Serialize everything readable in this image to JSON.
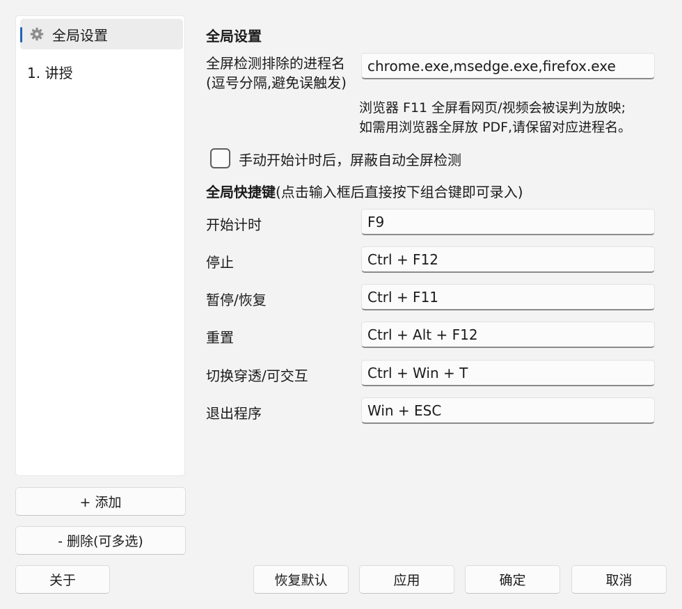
{
  "sidebar": {
    "items": [
      {
        "label": "全局设置",
        "icon": "gear-icon",
        "selected": true
      },
      {
        "label": "1. 讲授",
        "selected": false
      }
    ],
    "add_label": "+  添加",
    "delete_label": "-  删除(可多选)"
  },
  "about_label": "关于",
  "main": {
    "title": "全局设置",
    "exclude": {
      "label_line1": "全屏检测排除的进程名",
      "label_line2": "(逗号分隔,避免误触发)",
      "value": "chrome.exe,msedge.exe,firefox.exe"
    },
    "hint_line1": "浏览器 F11 全屏看网页/视频会被误判为放映;",
    "hint_line2": "如需用浏览器全屏放 PDF,请保留对应进程名。",
    "checkbox_label": "手动开始计时后，屏蔽自动全屏检测",
    "checkbox_checked": false,
    "hotkeys_title": "全局快捷键",
    "hotkeys_subtitle": "(点击输入框后直接按下组合键即可录入)",
    "hotkeys": [
      {
        "label": "开始计时",
        "value": "F9"
      },
      {
        "label": "停止",
        "value": "Ctrl + F12"
      },
      {
        "label": "暂停/恢复",
        "value": "Ctrl + F11"
      },
      {
        "label": "重置",
        "value": "Ctrl + Alt + F12"
      },
      {
        "label": "切换穿透/可交互",
        "value": "Ctrl + Win + T"
      },
      {
        "label": "退出程序",
        "value": "Win + ESC"
      }
    ]
  },
  "footer": {
    "restore_label": "恢复默认",
    "apply_label": "应用",
    "ok_label": "确定",
    "cancel_label": "取消"
  },
  "colors": {
    "accent": "#1f62b8",
    "background": "#f3f3f3",
    "panel": "#ffffff"
  }
}
